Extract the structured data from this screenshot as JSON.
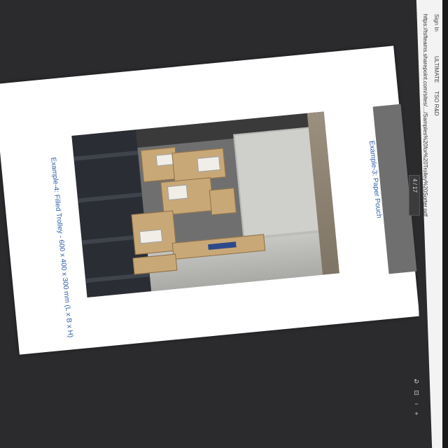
{
  "document": {
    "caption_left": "Example-4: Filled Trolley - 600 x 400 x 300 mm (L x B x H)",
    "caption_right": "Example-3: Paper Pouch"
  },
  "browser": {
    "url": "https://tsfteams.sharepoint.com/sites/…/Samples%20for%20Trolley%20Sorter.pdf",
    "tabs": [
      "Sign In",
      "ULTIMATE",
      "TSO R&D"
    ],
    "page_indicator": "4 / 17",
    "zoom": "100%"
  },
  "icons": {
    "zoom_in": "plus-icon",
    "zoom_out": "minus-icon",
    "rotate": "rotate-icon",
    "fit": "fit-page-icon"
  },
  "colors": {
    "caption": "#2f5da8",
    "page_bg": "#ffffff",
    "viewer_bg": "#2b2b2e"
  }
}
